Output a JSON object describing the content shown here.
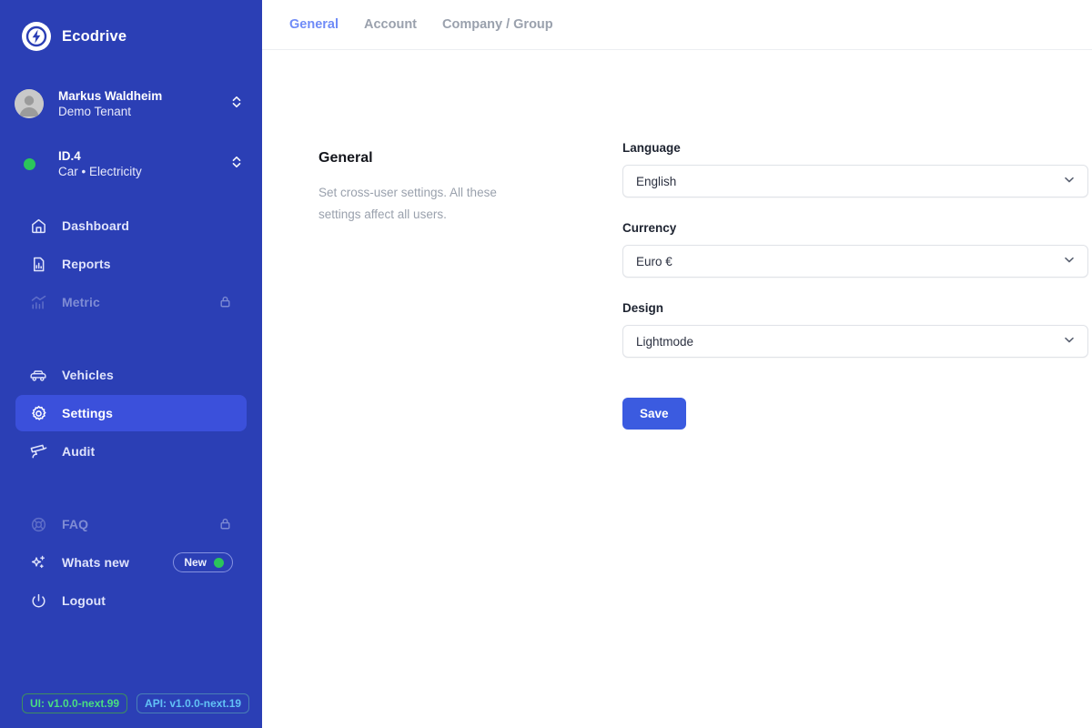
{
  "brand": {
    "name": "Ecodrive",
    "logo_icon": "lightning-bolt-icon"
  },
  "sidebar": {
    "background_color": "#2B3FB5",
    "active_item_color": "#3B50DB",
    "user": {
      "name": "Markus Waldheim",
      "tenant": "Demo Tenant",
      "avatar_icon": "user-avatar-icon",
      "switch_icon": "chevron-up-down-icon"
    },
    "vehicle": {
      "name": "ID.4",
      "details": "Car  •  Electricity",
      "status_color": "#2BC55B",
      "switch_icon": "chevron-up-down-icon"
    },
    "nav": [
      {
        "label": "Dashboard",
        "icon": "home-icon",
        "state": "default",
        "locked": false
      },
      {
        "label": "Reports",
        "icon": "document-chart-icon",
        "state": "default",
        "locked": false
      },
      {
        "label": "Metric",
        "icon": "chart-trend-icon",
        "state": "disabled",
        "locked": true,
        "lock_icon": "lock-icon"
      }
    ],
    "nav2": [
      {
        "label": "Vehicles",
        "icon": "car-icon",
        "state": "default",
        "locked": false
      },
      {
        "label": "Settings",
        "icon": "gear-icon",
        "state": "active",
        "locked": false
      },
      {
        "label": "Audit",
        "icon": "security-camera-icon",
        "state": "default",
        "locked": false
      }
    ],
    "nav3": [
      {
        "label": "FAQ",
        "icon": "lifebuoy-icon",
        "state": "disabled",
        "locked": true,
        "lock_icon": "lock-icon"
      },
      {
        "label": "Whats new",
        "icon": "sparkles-icon",
        "state": "default",
        "locked": false,
        "badge": "New",
        "badge_dot_color": "#2BC55B"
      },
      {
        "label": "Logout",
        "icon": "power-icon",
        "state": "default",
        "locked": false
      }
    ],
    "versions": {
      "ui": "UI: v1.0.0-next.99",
      "ui_color": "#4ADE80",
      "api": "API: v1.0.0-next.19",
      "api_color": "#62C2F5"
    }
  },
  "main": {
    "tabs": [
      {
        "label": "General",
        "active": true
      },
      {
        "label": "Account",
        "active": false
      },
      {
        "label": "Company / Group",
        "active": false
      }
    ],
    "section": {
      "title": "General",
      "description": "Set cross-user settings. All these settings affect all users."
    },
    "fields": [
      {
        "label": "Language",
        "value": "English",
        "chevron_icon": "chevron-down-icon"
      },
      {
        "label": "Currency",
        "value": "Euro €",
        "chevron_icon": "chevron-down-icon"
      },
      {
        "label": "Design",
        "value": "Lightmode",
        "chevron_icon": "chevron-down-icon"
      }
    ],
    "save_button": {
      "label": "Save",
      "color": "#3B5BE0"
    }
  }
}
